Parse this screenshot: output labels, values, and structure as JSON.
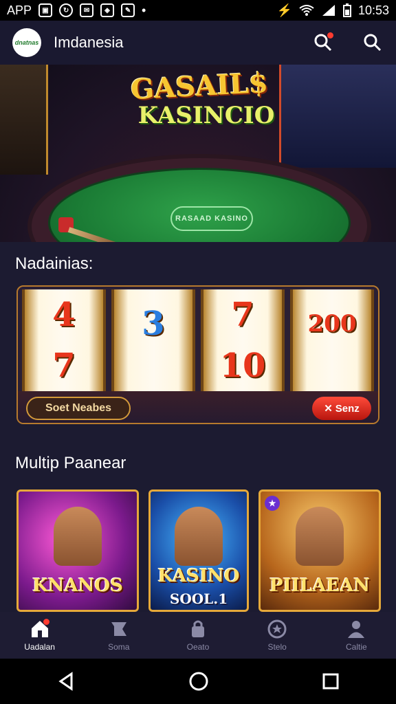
{
  "status_bar": {
    "app_label": "APP",
    "time": "10:53"
  },
  "app_bar": {
    "logo_text": "dnatnas",
    "title": "Imdanesia"
  },
  "hero": {
    "title_line1": "GASAIL$",
    "title_line2": "KASINCIO",
    "felt_badge": "RASAAD KASINO"
  },
  "section1": {
    "title": "Nadainias:"
  },
  "slot": {
    "reels": [
      {
        "top": "4",
        "bottom": "7"
      },
      {
        "top": "3",
        "bottom": ""
      },
      {
        "top": "7",
        "bottom": "10"
      },
      {
        "top": "200",
        "bottom": ""
      }
    ],
    "left_button": "Soet Neabes",
    "right_button": "Senz"
  },
  "section2": {
    "title": "Multip Paanear"
  },
  "games": [
    {
      "title": "KNANOS",
      "sub": ""
    },
    {
      "title": "KASINO",
      "sub": "SOOL.1"
    },
    {
      "title": "PIILAEAN",
      "sub": ""
    }
  ],
  "bottom_nav": [
    {
      "label": "Uadalan"
    },
    {
      "label": "Soma"
    },
    {
      "label": "Oeato"
    },
    {
      "label": "Stelo"
    },
    {
      "label": "Caltie"
    }
  ],
  "colors": {
    "accent": "#e6a93a",
    "background": "#1c1b31",
    "notification": "#ff3b30"
  }
}
